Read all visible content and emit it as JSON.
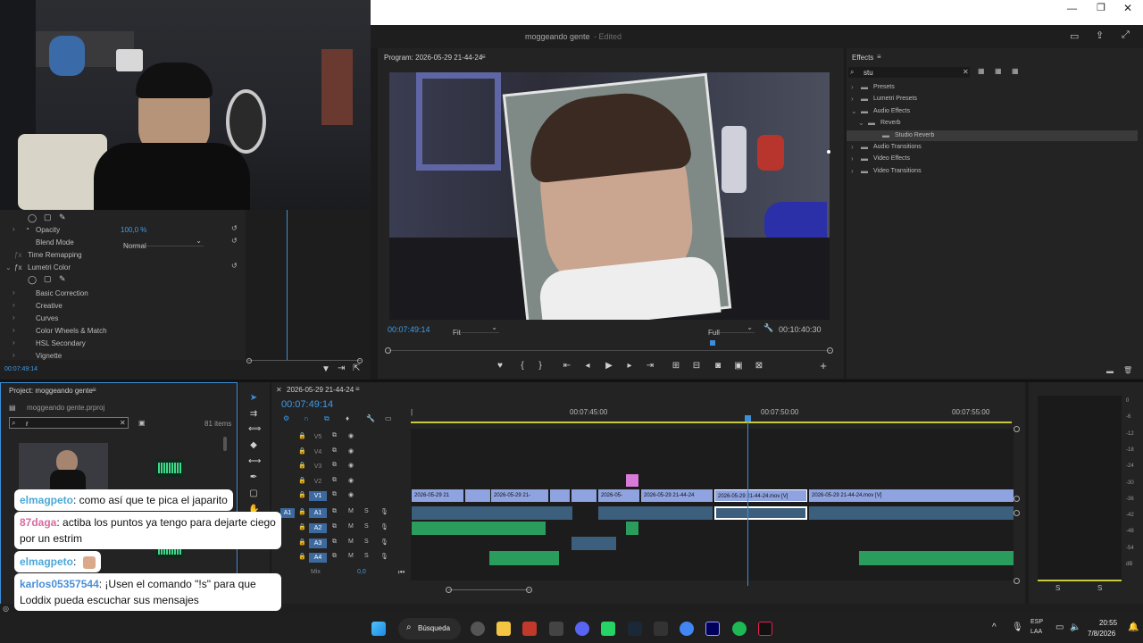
{
  "window": {
    "project_title": "moggeando gente",
    "edited_label": "- Edited"
  },
  "effect_controls": {
    "opacity_label": "Opacity",
    "opacity_value": "100,0 %",
    "blend_mode_label": "Blend Mode",
    "blend_mode_value": "Normal",
    "time_remapping_label": "Time Remapping",
    "lumetri_label": "Lumetri Color",
    "items": [
      "Basic Correction",
      "Creative",
      "Curves",
      "Color Wheels & Match",
      "HSL Secondary",
      "Vignette"
    ],
    "timecode": "00:07:49:14"
  },
  "program_monitor": {
    "title": "Program: 2026-05-29 21-44-24",
    "timecode": "00:07:49:14",
    "fit_label": "Fit",
    "quality_label": "Full",
    "duration": "00:10:40:30"
  },
  "effects_panel": {
    "title": "Effects",
    "search_value": "stu",
    "tree": [
      {
        "label": "Presets",
        "level": 0
      },
      {
        "label": "Lumetri Presets",
        "level": 0
      },
      {
        "label": "Audio Effects",
        "level": 0
      },
      {
        "label": "Reverb",
        "level": 1
      },
      {
        "label": "Studio Reverb",
        "level": 2
      },
      {
        "label": "Audio Transitions",
        "level": 0
      },
      {
        "label": "Video Effects",
        "level": 0
      },
      {
        "label": "Video Transitions",
        "level": 0
      }
    ]
  },
  "project_panel": {
    "title": "Project: moggeando gente",
    "file": "moggeando gente.prproj",
    "search_value": "r",
    "items_count": "81 items"
  },
  "timeline": {
    "sequence_name": "2026-05-29 21-44-24",
    "timecode": "00:07:49:14",
    "ruler": [
      "00:07:45:00",
      "00:07:50:00",
      "00:07:55:00"
    ],
    "video_tracks": [
      "V5",
      "V4",
      "V3",
      "V2",
      "V1"
    ],
    "audio_tracks": [
      "A1",
      "A2",
      "A3",
      "A4"
    ],
    "mix_label": "Mix",
    "mix_value": "0,0",
    "clips": {
      "c1": "2026-05-29 21",
      "c2": "2026-05-29 21-",
      "c3": "2026-05-",
      "c4": "2026-05-29 21-44-24",
      "c5": "2026-05-29 21-44-24.mov [V]",
      "c6": "2026-05-29 21-44-24.mov [V]"
    }
  },
  "meters": {
    "scale": [
      "0",
      "-6",
      "-12",
      "-18",
      "-24",
      "-30",
      "-36",
      "-42",
      "-48",
      "-54",
      "dB"
    ],
    "s_left": "S",
    "s_right": "S"
  },
  "chat": [
    {
      "user": "elmagpeto",
      "text": ": como así que te pica el japarito",
      "color": "#4aa8d8"
    },
    {
      "user": "87daga",
      "text": ": actiba los puntos ya tengo para dejarte ciego por un estrim",
      "color": "#d96aa0"
    },
    {
      "user": "elmagpeto",
      "text": ":",
      "color": "#4aa8d8"
    },
    {
      "user": "karlos05357544",
      "text": ": ¡Usen el comando \"!s\" para que Loddix pueda escuchar sus mensajes",
      "color": "#4a8fd8"
    }
  ],
  "taskbar": {
    "search_label": "Búsqueda",
    "lang_top": "ESP",
    "lang_bottom": "LAA",
    "time": "20:55",
    "date": "7/8/2026"
  }
}
